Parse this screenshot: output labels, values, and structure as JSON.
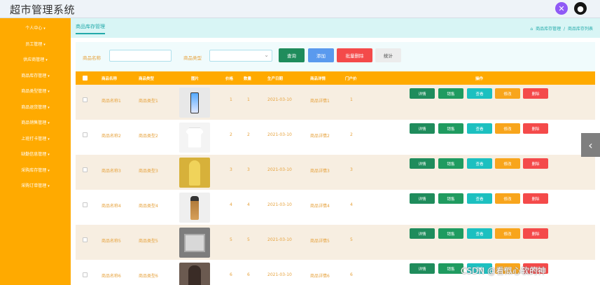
{
  "app": {
    "title": "超市管理系统"
  },
  "header": {
    "settings_icon": "settings-icon",
    "user_icon": "user-icon"
  },
  "sidebar": {
    "items": [
      {
        "label": "个人中心"
      },
      {
        "label": "员工管理"
      },
      {
        "label": "供应商管理"
      },
      {
        "label": "商品库存管理"
      },
      {
        "label": "商品类型管理"
      },
      {
        "label": "商品退货管理"
      },
      {
        "label": "商品销售管理"
      },
      {
        "label": "上班打卡管理"
      },
      {
        "label": "缺勤信息管理"
      },
      {
        "label": "采购库存管理"
      },
      {
        "label": "采购订单管理"
      }
    ]
  },
  "breadcrumb": {
    "tab": "商品库存管理",
    "home_icon": "home-icon",
    "path1": "商品库存管理",
    "sep": "/",
    "path2": "商品库存列表"
  },
  "filter": {
    "name_label": "商品名称",
    "name_value": "",
    "type_label": "商品类型",
    "type_value": "",
    "search_btn": "查询",
    "add_btn": "添加",
    "batch_delete_btn": "批量删除",
    "stats_btn": "统计"
  },
  "table": {
    "headers": [
      "商品名称",
      "商品类型",
      "图片",
      "价格",
      "数量",
      "生产日期",
      "商品详情",
      "门户价",
      "操作"
    ],
    "rows": [
      {
        "name": "商品名称1",
        "type": "商品类型1",
        "price": "1",
        "qty": "1",
        "date": "2021-03-10",
        "detail": "商品详情1",
        "portal": "1",
        "image": "phone"
      },
      {
        "name": "商品名称2",
        "type": "商品类型2",
        "price": "2",
        "qty": "2",
        "date": "2021-03-10",
        "detail": "商品详情2",
        "portal": "2",
        "image": "shirt"
      },
      {
        "name": "商品名称3",
        "type": "商品类型3",
        "price": "3",
        "qty": "3",
        "date": "2021-03-10",
        "detail": "商品详情3",
        "portal": "3",
        "image": "person"
      },
      {
        "name": "商品名称4",
        "type": "商品类型4",
        "price": "4",
        "qty": "4",
        "date": "2021-03-10",
        "detail": "商品详情4",
        "portal": "4",
        "image": "bottle"
      },
      {
        "name": "商品名称5",
        "type": "商品类型5",
        "price": "5",
        "qty": "5",
        "date": "2021-03-10",
        "detail": "商品详情5",
        "portal": "5",
        "image": "laptop"
      },
      {
        "name": "商品名称6",
        "type": "商品类型6",
        "price": "6",
        "qty": "6",
        "date": "2021-03-10",
        "detail": "商品详情6",
        "portal": "6",
        "image": "dark"
      }
    ],
    "actions": {
      "detail": "详情",
      "sale": "销售",
      "view": "查看",
      "edit": "修改",
      "delete": "删除"
    }
  },
  "watermark": "CSDN @看似心软的神",
  "colors": {
    "sidebar": "#ffaa00",
    "accent": "#2aa",
    "danger": "#f44a4a",
    "primary": "#1f8c5c"
  }
}
